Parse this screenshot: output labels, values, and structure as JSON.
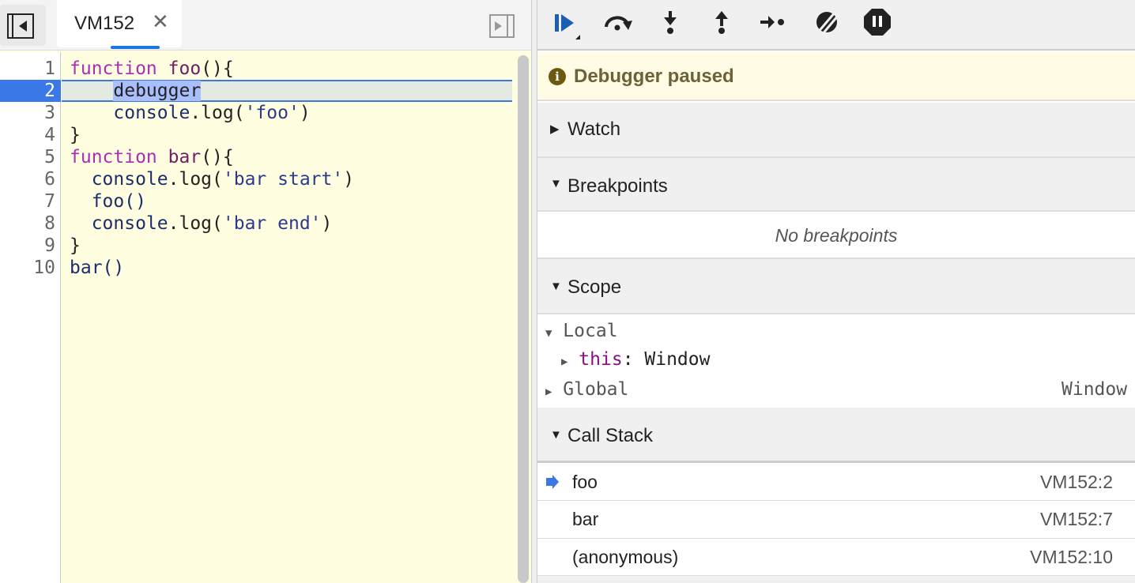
{
  "editor": {
    "tab_label": "VM152",
    "current_line": 2,
    "lines": [
      {
        "n": "1"
      },
      {
        "n": "2"
      },
      {
        "n": "3"
      },
      {
        "n": "4"
      },
      {
        "n": "5"
      },
      {
        "n": "6"
      },
      {
        "n": "7"
      },
      {
        "n": "8"
      },
      {
        "n": "9"
      },
      {
        "n": "10"
      }
    ],
    "code": {
      "l1a": "function",
      "l1b": "foo",
      "l1c": "(){",
      "l2": "debugger",
      "l3a": "console",
      "l3b": ".log(",
      "l3c": "'foo'",
      "l3d": ")",
      "l4": "}",
      "l5a": "function",
      "l5b": "bar",
      "l5c": "(){",
      "l6a": "console",
      "l6b": ".log(",
      "l6c": "'bar start'",
      "l6d": ")",
      "l7": "foo()",
      "l8a": "console",
      "l8b": ".log(",
      "l8c": "'bar end'",
      "l8d": ")",
      "l9": "}",
      "l10": "bar()"
    }
  },
  "debugger": {
    "status": "Debugger paused",
    "accent": "#1a5fb4",
    "sections": {
      "watch": "Watch",
      "breakpoints": "Breakpoints",
      "no_breakpoints": "No breakpoints",
      "scope": "Scope",
      "call_stack": "Call Stack"
    },
    "scope": {
      "local": "Local",
      "this_key": "this",
      "this_val": "Window",
      "global": "Global",
      "global_val": "Window"
    },
    "call_stack": [
      {
        "name": "foo",
        "location": "VM152:2"
      },
      {
        "name": "bar",
        "location": "VM152:7"
      },
      {
        "name": "(anonymous)",
        "location": "VM152:10"
      }
    ]
  }
}
